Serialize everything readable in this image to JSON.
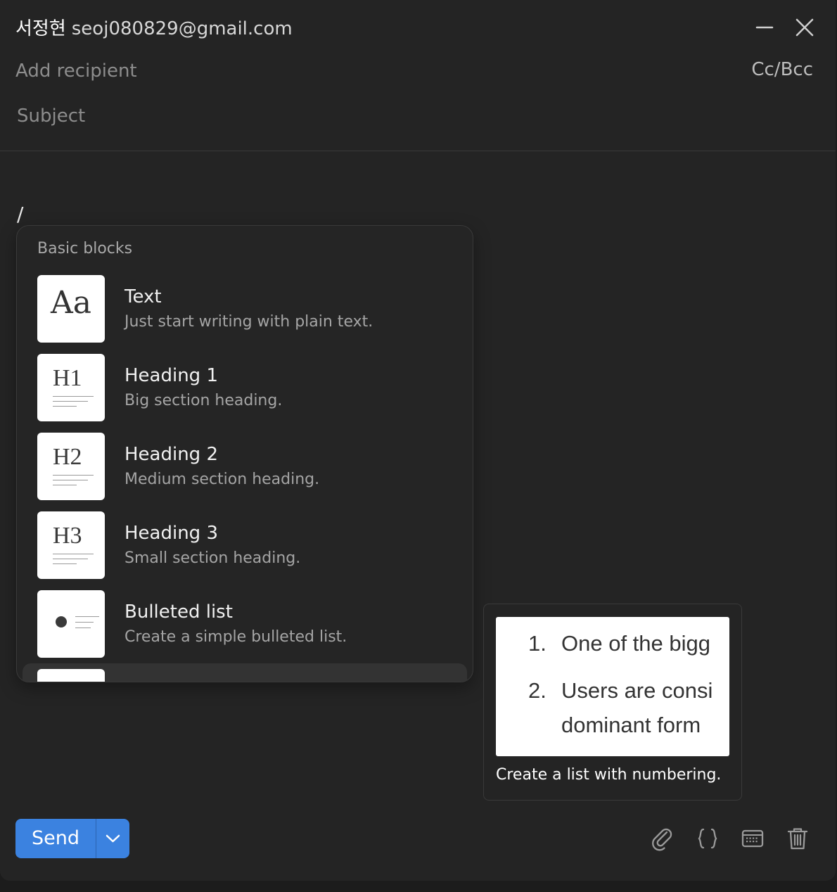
{
  "header": {
    "sender_name": "서정현",
    "sender_email": "seoj080829@gmail.com",
    "minimize_icon": "minimize-icon",
    "close_icon": "close-icon"
  },
  "fields": {
    "recipient_placeholder": "Add recipient",
    "cc_bcc_label": "Cc/Bcc",
    "subject_placeholder": "Subject"
  },
  "editor": {
    "content": "/"
  },
  "block_menu": {
    "section_title": "Basic blocks",
    "items": [
      {
        "label": "Text",
        "description": "Just start writing with plain text.",
        "thumb_text": "Aa",
        "icon": "text-block-icon"
      },
      {
        "label": "Heading 1",
        "description": "Big section heading.",
        "thumb_text": "H1",
        "icon": "heading-1-icon"
      },
      {
        "label": "Heading 2",
        "description": "Medium section heading.",
        "thumb_text": "H2",
        "icon": "heading-2-icon"
      },
      {
        "label": "Heading 3",
        "description": "Small section heading.",
        "thumb_text": "H3",
        "icon": "heading-3-icon"
      },
      {
        "label": "Bulleted list",
        "description": "Create a simple bulleted list.",
        "icon": "bulleted-list-icon"
      }
    ]
  },
  "preview": {
    "lines": [
      {
        "num": "1.",
        "text": "One of the bigg"
      },
      {
        "num": "2.",
        "text": "Users are consi"
      },
      {
        "num": "",
        "text": "dominant form"
      }
    ],
    "caption": "Create a list with numbering."
  },
  "footer": {
    "send_label": "Send",
    "icons": [
      "send-options-chevron-icon",
      "paperclip-icon",
      "curly-braces-icon",
      "keyboard-icon",
      "trash-icon"
    ]
  },
  "colors": {
    "background": "#242424",
    "accent": "#3b82e0",
    "text_muted": "#8d8d8d"
  }
}
